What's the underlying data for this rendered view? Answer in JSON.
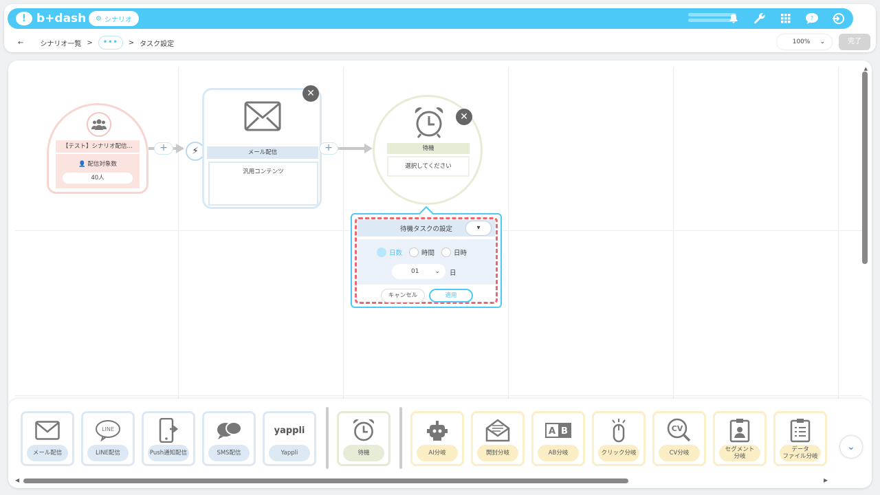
{
  "header": {
    "logo_text": "b+dash",
    "app_chip": "シナリオ",
    "icons": [
      "bell-icon",
      "wrench-icon",
      "grid-icon",
      "help-icon",
      "logout-icon"
    ]
  },
  "breadcrumb": {
    "back": "←",
    "root": "シナリオ一覧",
    "sep": ">",
    "more": "•••",
    "current": "タスク設定"
  },
  "zoom": {
    "value": "100%"
  },
  "done_button": "完了",
  "nodes": {
    "start": {
      "title": "【テスト】シナリオ配信…",
      "label": "配信対象数",
      "count": "40人"
    },
    "mail": {
      "title": "メール配信",
      "content": "汎用コンテンツ"
    },
    "wait": {
      "title": "待機",
      "content": "選択してください"
    },
    "plus": "+",
    "close": "✕"
  },
  "popup": {
    "title": "待機タスクの設定",
    "options": [
      "日数",
      "時間",
      "日時"
    ],
    "selected_option": "日数",
    "select_value": "01",
    "unit": "日",
    "cancel": "キャンセル",
    "apply": "適用"
  },
  "palette": {
    "items": [
      {
        "label": "メール配信",
        "group": "delivery",
        "icon": "mail-icon"
      },
      {
        "label": "LINE配信",
        "group": "delivery",
        "icon": "line-icon"
      },
      {
        "label": "Push通知配信",
        "group": "delivery",
        "icon": "push-icon"
      },
      {
        "label": "SMS配信",
        "group": "delivery",
        "icon": "sms-icon"
      },
      {
        "label": "Yappli",
        "group": "delivery",
        "icon": "yappli-logo"
      },
      {
        "label": "待機",
        "group": "wait",
        "icon": "clock-icon"
      },
      {
        "label": "AI分岐",
        "group": "branch",
        "icon": "robot-icon"
      },
      {
        "label": "開封分岐",
        "group": "branch",
        "icon": "open-mail-icon"
      },
      {
        "label": "AB分岐",
        "group": "branch",
        "icon": "ab-icon"
      },
      {
        "label": "クリック分岐",
        "group": "branch",
        "icon": "click-icon"
      },
      {
        "label": "CV分岐",
        "group": "branch",
        "icon": "cv-icon"
      },
      {
        "label": "セグメント\n分岐",
        "group": "branch",
        "icon": "segment-icon"
      },
      {
        "label": "データ\nファイル分岐",
        "group": "branch",
        "icon": "datafile-icon"
      }
    ],
    "yappli_text": "yappli",
    "line_text": "LINE",
    "ab_text": "A B",
    "cv_text": "CV"
  },
  "colors": {
    "accent": "#4cc9f6",
    "highlight_dash": "#ea6870"
  }
}
